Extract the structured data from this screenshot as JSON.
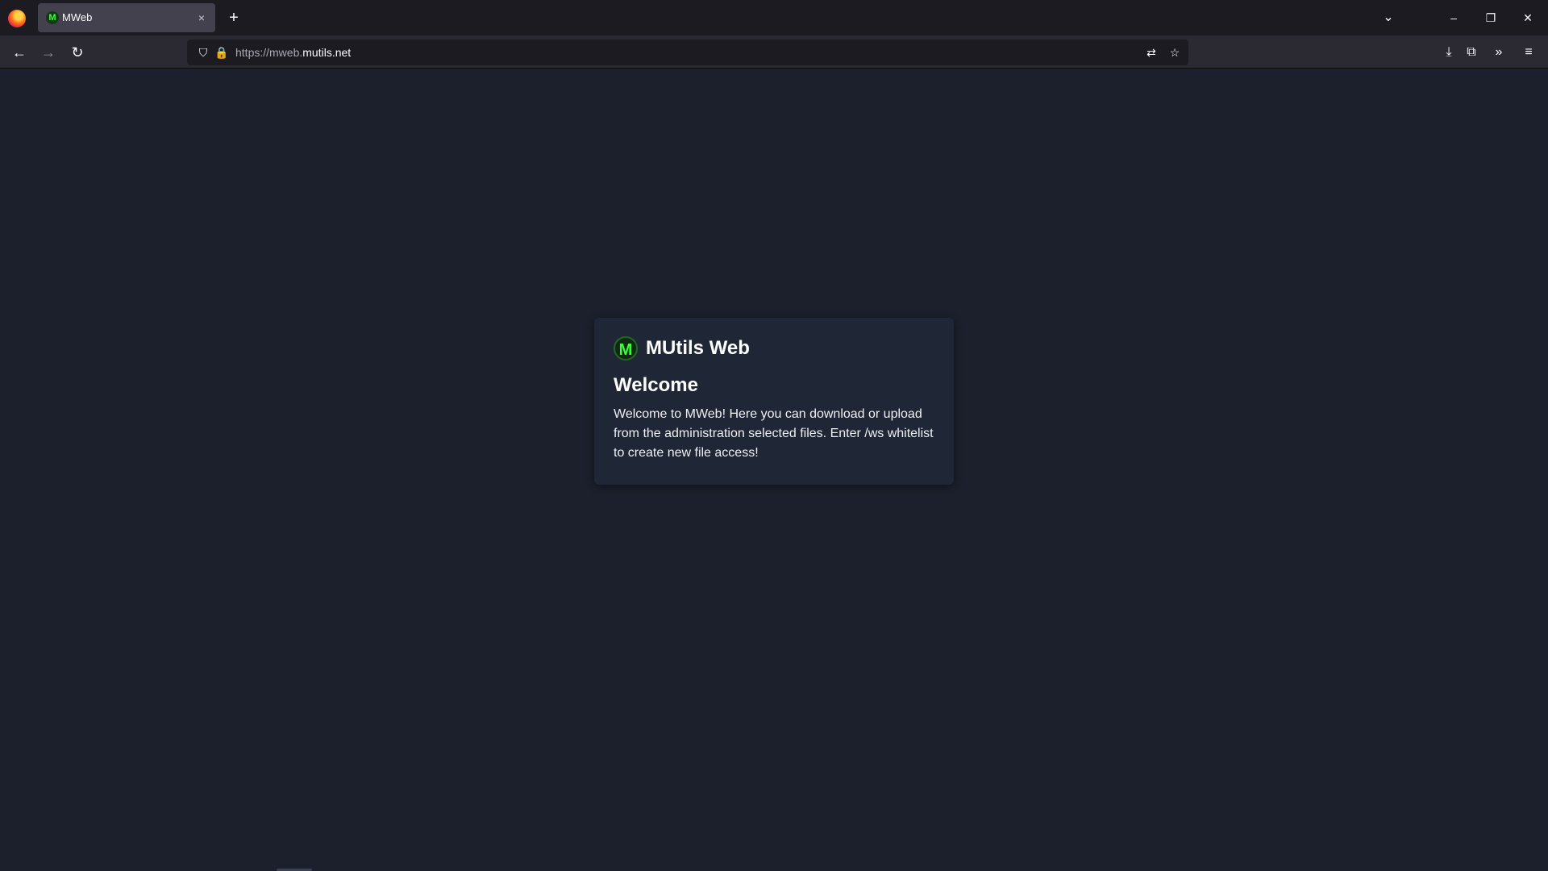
{
  "browser": {
    "tab": {
      "title": "MWeb",
      "favicon": "mutils-favicon"
    },
    "new_tab_label": "+",
    "url": {
      "scheme": "https://mweb.",
      "host": "mutils.net"
    }
  },
  "icons": {
    "close": "×",
    "chevron": "⌄",
    "minimize": "–",
    "restore": "❐",
    "window_close": "✕",
    "back": "←",
    "forward": "→",
    "reload": "↻",
    "shield": "⛉",
    "lock": "🔒",
    "translate": "⇄",
    "star": "☆",
    "download": "⤓",
    "extensions": "⧉",
    "overflow": "»",
    "menu": "≡",
    "logo": "M"
  },
  "card": {
    "brand": "MUtils Web",
    "title": "Welcome",
    "text": "Welcome to MWeb! Here you can download or upload from the administration selected files. Enter /ws whitelist to create new file access!"
  },
  "colors": {
    "page_bg": "#1b202c",
    "card_bg": "#1f2736",
    "toolbar_bg": "#2b2a33",
    "titlebar_bg": "#1c1b22",
    "logo_green": "#3cff3c"
  }
}
